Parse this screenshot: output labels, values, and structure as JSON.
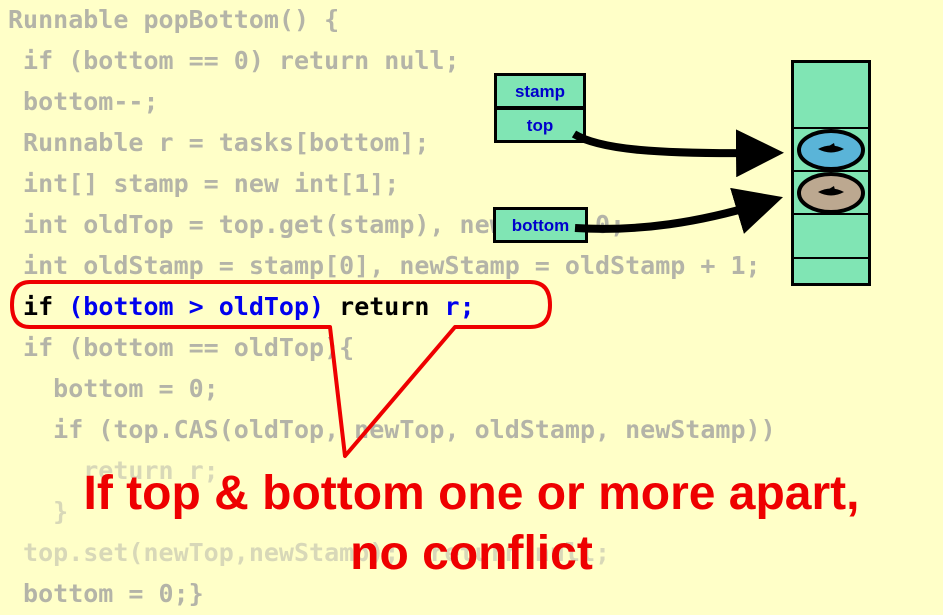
{
  "code": {
    "line1": "Runnable popBottom() {",
    "line2": " if (bottom == 0) return null;",
    "line3": " bottom--;",
    "line4": " Runnable r = tasks[bottom];",
    "line5": " int[] stamp = new int[1];",
    "line6": " int oldTop = top.get(stamp), newTop = 0;",
    "line7": " int oldStamp = stamp[0], newStamp = oldStamp + 1;",
    "line8_if": " if ",
    "line8_cond": "(bottom > oldTop) ",
    "line8_ret": "return ",
    "line8_r": "r;",
    "line9": " if (bottom == oldTop){",
    "line10": "   bottom = 0;",
    "line11": "   if (top.CAS(oldTop, newTop, oldStamp, newStamp))",
    "line12": "     return r;",
    "line13": "   }",
    "line14": " top.set(newTop,newStamp);  return null;",
    "line15": " bottom = 0;}"
  },
  "pointers": {
    "stamp": "stamp",
    "top": "top",
    "bottom": "bottom"
  },
  "caption": {
    "line1": "If top & bottom one or more apart,",
    "line2": "no conflict"
  },
  "colors": {
    "background": "#ffffc8",
    "highlight": "#ee0000",
    "box_fill": "#80e5b4",
    "task_blue": "#5ab4d8",
    "task_tan": "#bca890"
  }
}
